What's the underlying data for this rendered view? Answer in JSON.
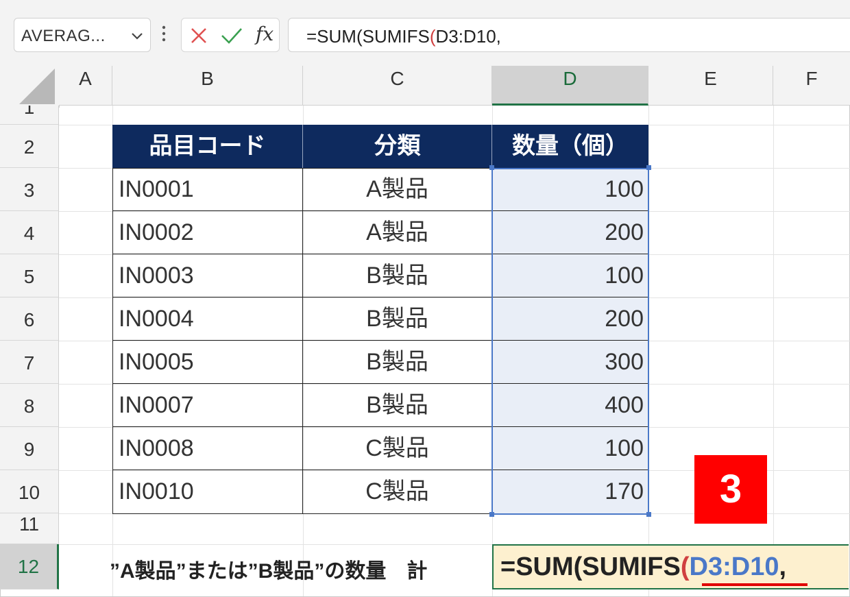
{
  "formula_bar": {
    "name_box": "AVERAG...",
    "cancel_icon": "x-icon",
    "enter_icon": "checkmark-icon",
    "fx_label": "fx",
    "formula_prefix": "=SUM(SUMIFS",
    "formula_paren": "(",
    "formula_suffix": "D3:D10,"
  },
  "columns": [
    "A",
    "B",
    "C",
    "D",
    "E",
    "F"
  ],
  "rows": [
    "1",
    "2",
    "3",
    "4",
    "5",
    "6",
    "7",
    "8",
    "9",
    "10",
    "11",
    "12"
  ],
  "table": {
    "headers": [
      "品目コード",
      "分類",
      "数量（個）"
    ],
    "rows": [
      {
        "code": "IN0001",
        "cat": "A製品",
        "qty": "100"
      },
      {
        "code": "IN0002",
        "cat": "A製品",
        "qty": "200"
      },
      {
        "code": "IN0003",
        "cat": "B製品",
        "qty": "100"
      },
      {
        "code": "IN0004",
        "cat": "B製品",
        "qty": "200"
      },
      {
        "code": "IN0005",
        "cat": "B製品",
        "qty": "300"
      },
      {
        "code": "IN0007",
        "cat": "B製品",
        "qty": "400"
      },
      {
        "code": "IN0008",
        "cat": "C製品",
        "qty": "100"
      },
      {
        "code": "IN0010",
        "cat": "C製品",
        "qty": "170"
      }
    ]
  },
  "row12_label": "”A製品”または”B製品”の数量　計",
  "edit_cell": {
    "prefix": "=SUM(SUMIFS",
    "paren": "(",
    "ref": "D3:D10",
    "comma": ","
  },
  "step_badge": "3",
  "colors": {
    "header_bg": "#0e2a5e",
    "selection": "#217346",
    "range_highlight": "#4a78c8",
    "badge": "#ff0000"
  }
}
